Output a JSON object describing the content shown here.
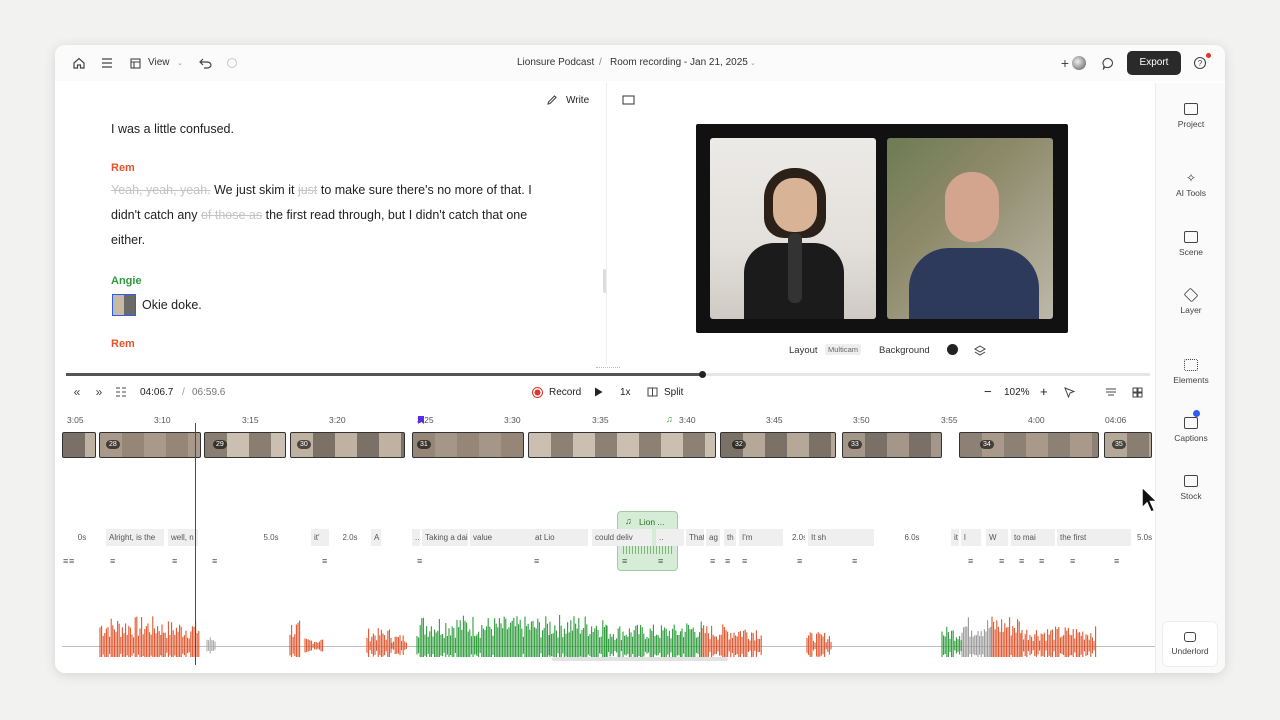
{
  "topbar": {
    "view_label": "View",
    "project": "Lionsure Podcast",
    "separator": "/",
    "composition": "Room recording - Jan 21, 2025",
    "export_label": "Export"
  },
  "editor": {
    "write_label": "Write",
    "line1": "I was a little confused.",
    "speaker1": "Rem",
    "struck1": "Yeah, yeah, yeah.",
    "t1": "We just skim it",
    "struck2": "just",
    "t2": "to make sure there's no more of that. I",
    "t3": "didn't catch any",
    "struck3": "of those as",
    "t4": "the first read through, but I didn't catch that one",
    "t5": "either.",
    "speaker2": "Angie",
    "t6": "Okie doke.",
    "speaker3": "Rem"
  },
  "preview": {
    "layout_label": "Layout",
    "layout_value": "Multicam",
    "background_label": "Background"
  },
  "rail": {
    "project": "Project",
    "ai_tools": "AI Tools",
    "scene": "Scene",
    "layer": "Layer",
    "elements": "Elements",
    "captions": "Captions",
    "stock": "Stock",
    "underlord": "Underlord"
  },
  "transport": {
    "current_time": "04:06.7",
    "time_sep": "/",
    "total_time": "06:59.6",
    "record_label": "Record",
    "speed_label": "1x",
    "split_label": "Split",
    "zoom_label": "102%",
    "zoom_minus": "−",
    "zoom_plus": "+"
  },
  "ruler": [
    "3:05",
    "3:10",
    "3:15",
    "3:20",
    "3:25",
    "3:30",
    "3:35",
    "3:40",
    "3:45",
    "3:50",
    "3:55",
    "4:00",
    "04:06"
  ],
  "scene_numbers": [
    "28",
    "29",
    "30",
    "31",
    "32",
    "33",
    "34",
    "35",
    "36"
  ],
  "music_clip": "Lion ...",
  "captions": [
    "0s",
    "Alright, is the",
    "well, n",
    "5.0s",
    "it'",
    "2.0s",
    "A",
    "...",
    "Taking a daily multivitami",
    "value",
    "at Lio",
    "could deliv",
    "..",
    "That's",
    "ag",
    "th",
    "I'm",
    "2.0s",
    "It sh",
    "6.0s",
    "it c",
    "l",
    "W",
    "to mai",
    "the first",
    "5.0s"
  ],
  "colors": {
    "rem": "#e0552d",
    "angie": "#2e9c3c",
    "playhead": "#2f5cf0",
    "record": "#e0352d",
    "export_bg": "#2a2a2a"
  }
}
